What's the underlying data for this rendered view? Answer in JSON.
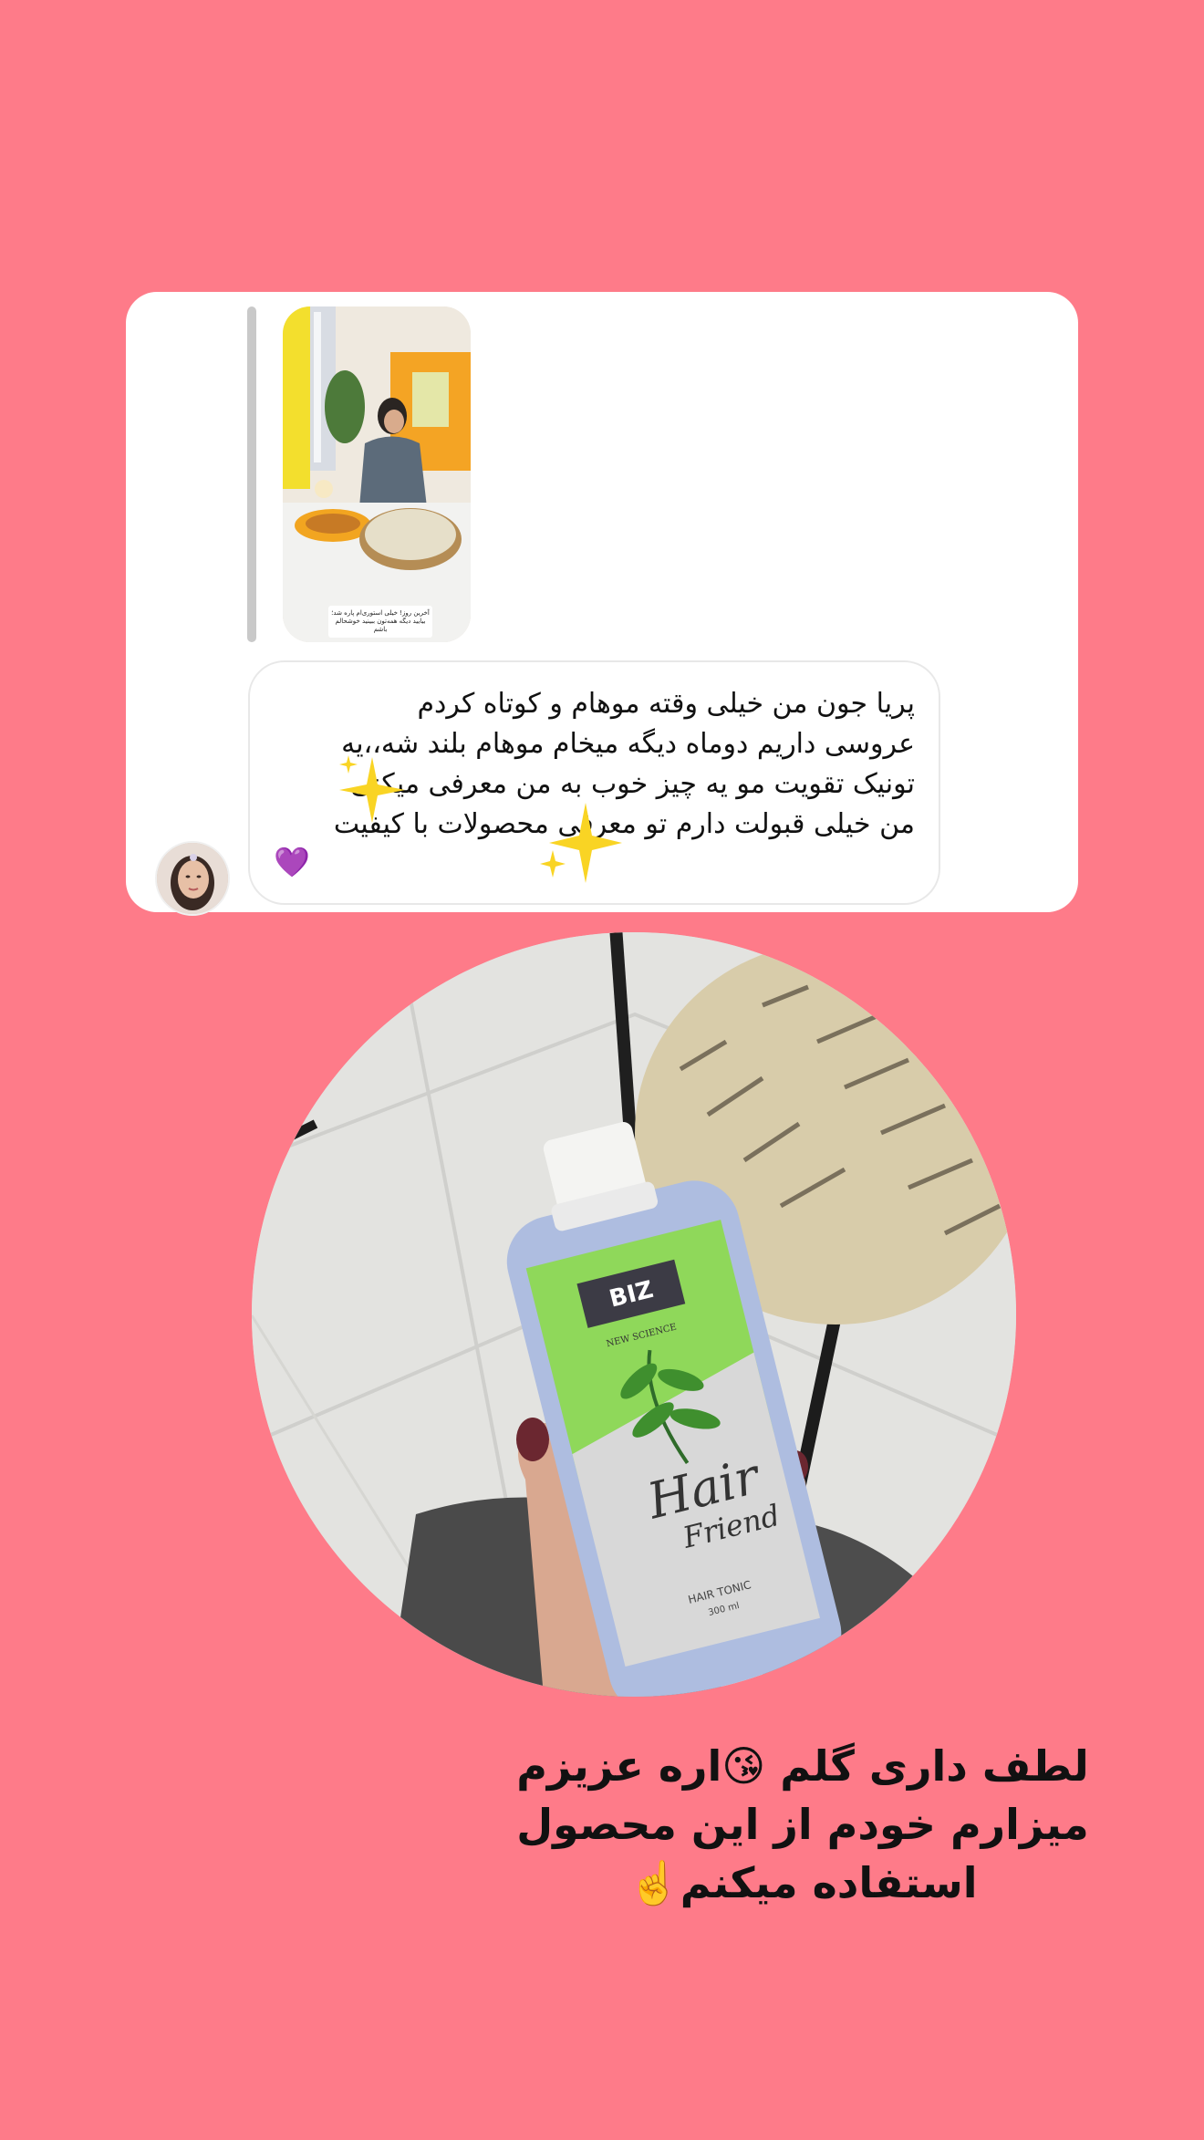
{
  "story_reply": {
    "story_caption": "آخرین روز! خیلی استوری‌ام پاره شد؛ بیایید دیگه همه‌تون ببینید خوشحالم باشم",
    "message_lines": [
      "پریا جون من  خیلی وقته موهام و کوتاه کردم",
      "عروسی داریم دوماه دیگه میخام موهام بلند شه،،یه",
      "تونیک تقویت مو یه چیز خوب به من معرفی میکنی",
      "من خیلی قبولت دارم تو معرفی محصولات با کیفیت"
    ],
    "heart_emoji": "💜",
    "sparkle_emoji": "✨"
  },
  "product": {
    "brand": "BIZ",
    "tagline": "NEW SCIENCE",
    "name_line1": "Hair",
    "name_line2": "Friend",
    "type": "HAIR TONIC",
    "volume": "300 ml"
  },
  "answer": {
    "line1": "لطف داری گلم 😘اره عزیزم",
    "line2": "میزارم خودم از این محصول",
    "line3": "استفاده میکنم☝️"
  },
  "colors": {
    "background": "#fe7b89",
    "card": "#ffffff",
    "bottle_label_green": "#8fd85a"
  }
}
